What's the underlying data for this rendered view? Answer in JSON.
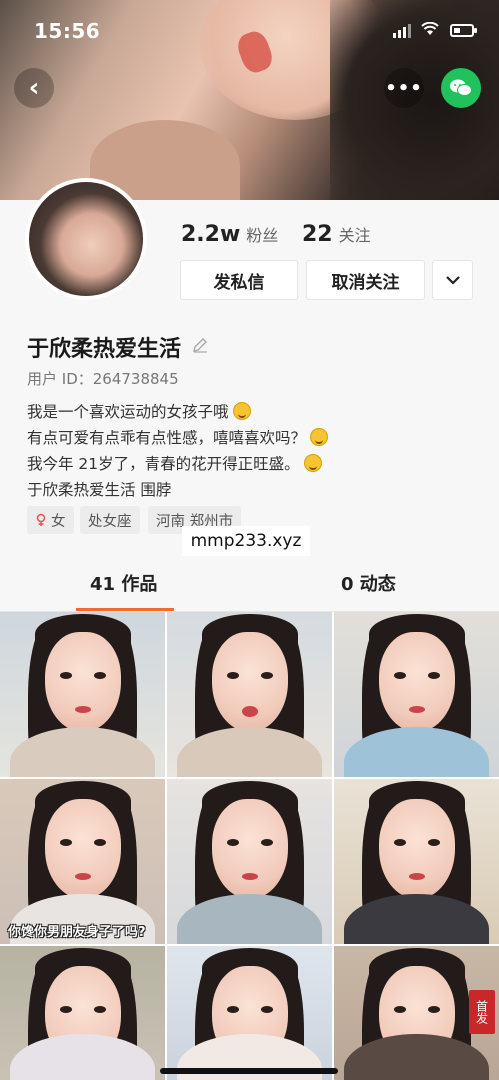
{
  "status_bar": {
    "time": "15:56"
  },
  "header": {
    "back_glyph": "‹",
    "more_glyph": "•••"
  },
  "profile": {
    "fans_count": "2.2w",
    "fans_label": "粉丝",
    "following_count": "22",
    "following_label": "关注",
    "message_button": "发私信",
    "unfollow_button": "取消关注",
    "name": "于欣柔热爱生活",
    "user_id": "用户 ID：264738845",
    "bio": [
      "我是一个喜欢运动的女孩子哦",
      "有点可爱有点乖有点性感，嘻嘻喜欢吗？",
      "我今年 21岁了，青春的花开得正旺盛。",
      "于欣柔热爱生活 围脖"
    ],
    "tags": [
      "女",
      "处女座",
      "河南 郑州市"
    ]
  },
  "watermark": "mmp233.xyz",
  "tabs": {
    "works": "41 作品",
    "dynamics": "0 动态"
  },
  "grid": {
    "captions": [
      "你馋你男朋友身子了吗?"
    ],
    "badge": "首发"
  },
  "colors": {
    "accent": "#f56a2c",
    "wechat": "#21c15b"
  },
  "icons": [
    "back-icon",
    "more-icon",
    "wechat-icon",
    "pencil-icon",
    "chevron-down-icon",
    "female-icon"
  ]
}
